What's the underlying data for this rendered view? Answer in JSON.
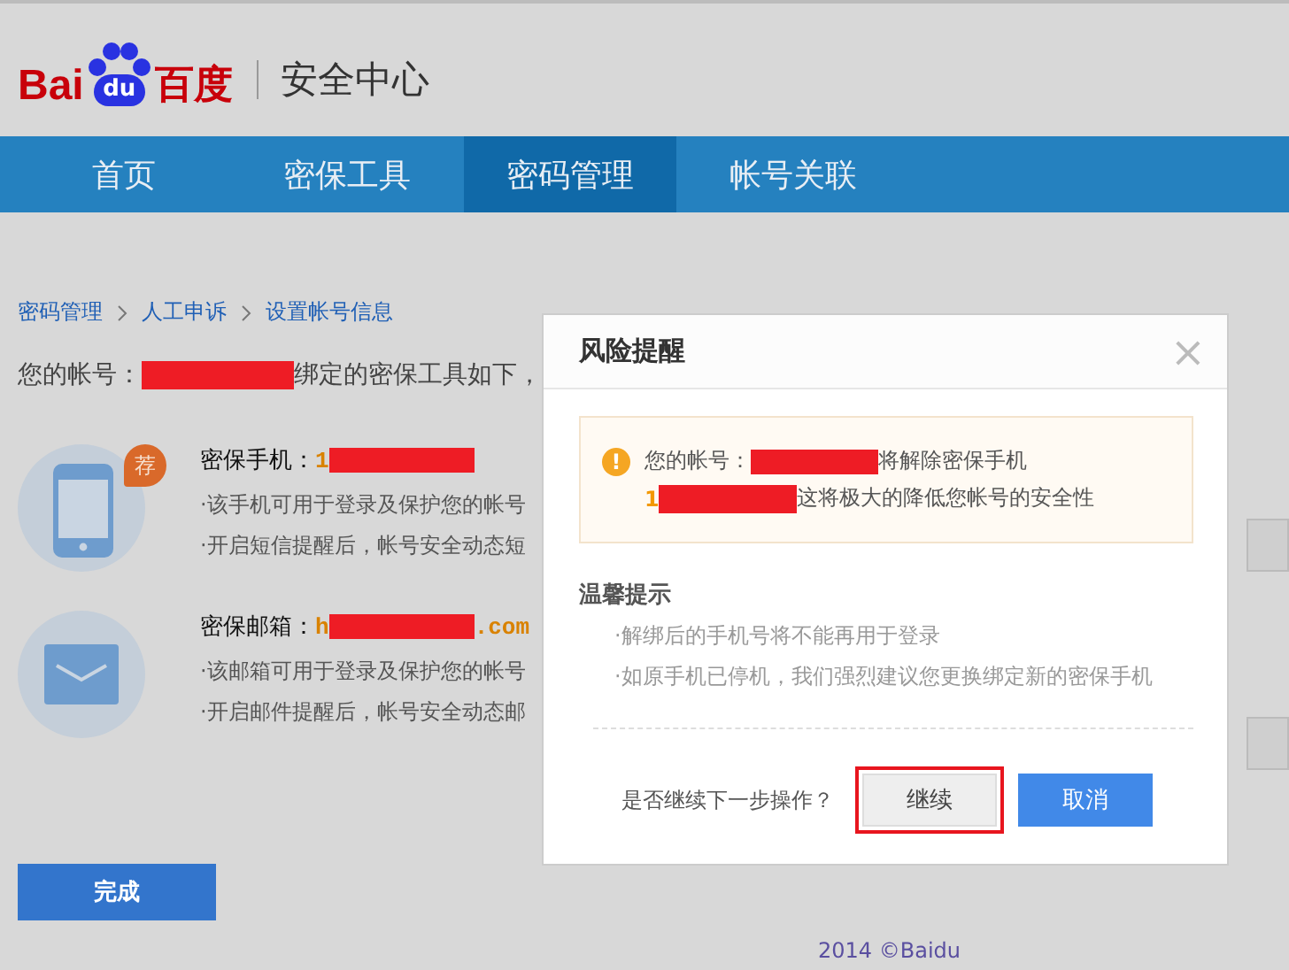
{
  "header": {
    "logo_latin": "Bai",
    "logo_paw": "du",
    "logo_cn": "百度",
    "title": "安全中心"
  },
  "nav": [
    {
      "label": "首页",
      "selected": false
    },
    {
      "label": "密保工具",
      "selected": false
    },
    {
      "label": "密码管理",
      "selected": true
    },
    {
      "label": "帐号关联",
      "selected": false
    }
  ],
  "breadcrumb": [
    "密码管理",
    "人工申诉",
    "设置帐号信息"
  ],
  "account_line": {
    "prefix": "您的帐号：",
    "suffix": "绑定的密保工具如下，"
  },
  "tools": [
    {
      "kind": "phone",
      "badge": "荐",
      "label": "密保手机：",
      "value_start": "1",
      "notes": [
        "·该手机可用于登录及保护您的帐号",
        "·开启短信提醒后，帐号安全动态短"
      ]
    },
    {
      "kind": "email",
      "label": "密保邮箱：",
      "value_start": "h",
      "value_end": ".com",
      "notes": [
        "·该邮箱可用于登录及保护您的帐号",
        "·开启邮件提醒后，帐号安全动态邮"
      ]
    }
  ],
  "done_button": "完成",
  "footer": "2014 ©Baidu",
  "dialog": {
    "title": "风险提醒",
    "close": "×",
    "warning": {
      "icon": "!",
      "line1_prefix": "您的帐号：",
      "line1_suffix": "将解除密保手机",
      "line2_prefix": "1",
      "line2_suffix": "这将极大的降低您帐号的安全性"
    },
    "tips_title": "温馨提示",
    "tips": [
      "·解绑后的手机号将不能再用于登录",
      "·如原手机已停机，我们强烈建议您更换绑定新的密保手机"
    ],
    "question": "是否继续下一步操作？",
    "buttons": [
      {
        "label": "继续",
        "kind": "secondary",
        "highlighted": true
      },
      {
        "label": "取消",
        "kind": "primary",
        "highlighted": false
      }
    ]
  }
}
